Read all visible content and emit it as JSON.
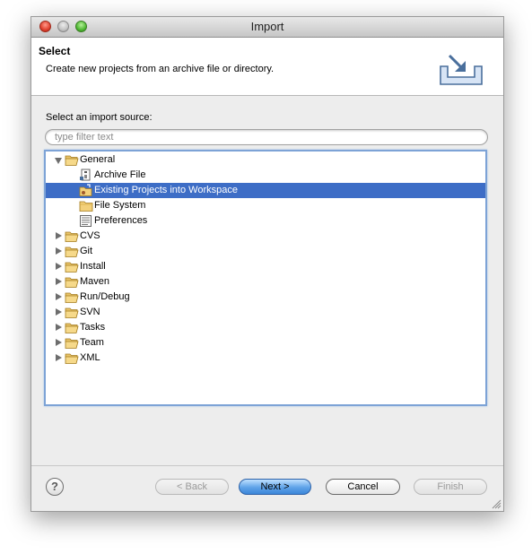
{
  "window": {
    "title": "Import"
  },
  "header": {
    "title": "Select",
    "description": "Create new projects from an archive file or directory."
  },
  "source": {
    "label": "Select an import source:",
    "filter_placeholder": "type filter text",
    "filter_value": ""
  },
  "tree": {
    "items": [
      {
        "label": "General",
        "expanded": true,
        "icon": "folder-open-icon"
      },
      {
        "label": "Archive File",
        "icon": "archive-file-icon"
      },
      {
        "label": "Existing Projects into Workspace",
        "icon": "existing-projects-icon",
        "selected": true
      },
      {
        "label": "File System",
        "icon": "folder-icon"
      },
      {
        "label": "Preferences",
        "icon": "preferences-icon"
      },
      {
        "label": "CVS",
        "icon": "folder-open-icon"
      },
      {
        "label": "Git",
        "icon": "folder-open-icon"
      },
      {
        "label": "Install",
        "icon": "folder-open-icon"
      },
      {
        "label": "Maven",
        "icon": "folder-open-icon"
      },
      {
        "label": "Run/Debug",
        "icon": "folder-open-icon"
      },
      {
        "label": "SVN",
        "icon": "folder-open-icon"
      },
      {
        "label": "Tasks",
        "icon": "folder-open-icon"
      },
      {
        "label": "Team",
        "icon": "folder-open-icon"
      },
      {
        "label": "XML",
        "icon": "folder-open-icon"
      }
    ]
  },
  "buttons": {
    "help": "?",
    "back": "< Back",
    "next": "Next >",
    "cancel": "Cancel",
    "finish": "Finish"
  },
  "colors": {
    "selection": "#3d6dc6",
    "focus_ring": "#7da3d6",
    "default_button": "#5fa3e8"
  }
}
